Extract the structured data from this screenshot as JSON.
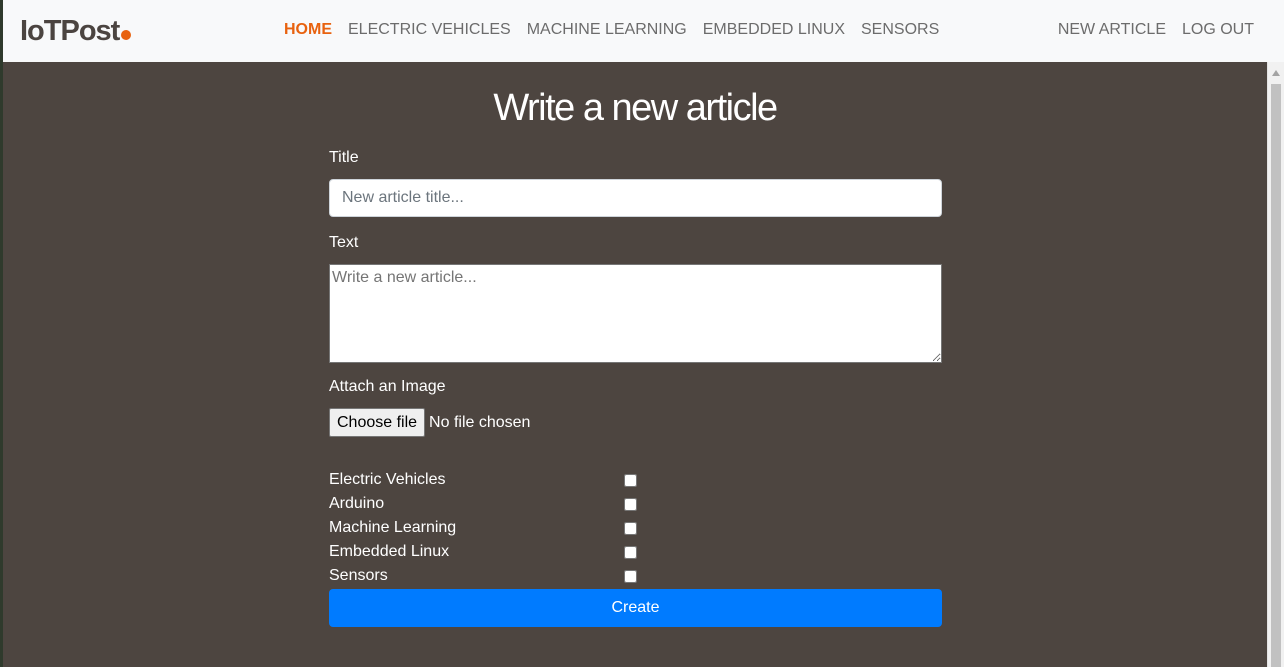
{
  "colors": {
    "accent": "#e8620f",
    "nav_active": "#e8620f",
    "primary_button": "#007bff",
    "page_background": "#4d4540"
  },
  "brand": {
    "name": "IoTPost"
  },
  "nav": {
    "items": [
      {
        "label": "HOME",
        "active": true
      },
      {
        "label": "ELECTRIC VEHICLES",
        "active": false
      },
      {
        "label": "MACHINE LEARNING",
        "active": false
      },
      {
        "label": "EMBEDDED LINUX",
        "active": false
      },
      {
        "label": "SENSORS",
        "active": false
      }
    ],
    "right_items": [
      {
        "label": "NEW ARTICLE"
      },
      {
        "label": "LOG OUT"
      }
    ]
  },
  "form": {
    "heading": "Write a new article",
    "title_label": "Title",
    "title_placeholder": "New article title...",
    "title_value": "",
    "text_label": "Text",
    "text_placeholder": "Write a new article...",
    "text_value": "",
    "image_label": "Attach an Image",
    "file_button_label": "Choose file",
    "file_status": "No file chosen",
    "categories": [
      {
        "label": "Electric Vehicles",
        "checked": false
      },
      {
        "label": "Arduino",
        "checked": false
      },
      {
        "label": "Machine Learning",
        "checked": false
      },
      {
        "label": "Embedded Linux",
        "checked": false
      },
      {
        "label": "Sensors",
        "checked": false
      }
    ],
    "submit_label": "Create"
  }
}
